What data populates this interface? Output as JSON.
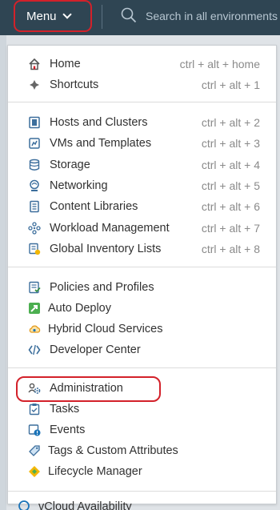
{
  "topbar": {
    "menu_label": "Menu",
    "search_placeholder": "Search in all environments"
  },
  "menu": {
    "group1": [
      {
        "label": "Home",
        "shortcut": "ctrl + alt + home",
        "icon": "home-icon"
      },
      {
        "label": "Shortcuts",
        "shortcut": "ctrl + alt + 1",
        "icon": "shortcuts-icon"
      }
    ],
    "group2": [
      {
        "label": "Hosts and Clusters",
        "shortcut": "ctrl + alt + 2",
        "icon": "hosts-clusters-icon"
      },
      {
        "label": "VMs and Templates",
        "shortcut": "ctrl + alt + 3",
        "icon": "vms-templates-icon"
      },
      {
        "label": "Storage",
        "shortcut": "ctrl + alt + 4",
        "icon": "storage-icon"
      },
      {
        "label": "Networking",
        "shortcut": "ctrl + alt + 5",
        "icon": "networking-icon"
      },
      {
        "label": "Content Libraries",
        "shortcut": "ctrl + alt + 6",
        "icon": "content-libraries-icon"
      },
      {
        "label": "Workload Management",
        "shortcut": "ctrl + alt + 7",
        "icon": "workload-management-icon"
      },
      {
        "label": "Global Inventory Lists",
        "shortcut": "ctrl + alt + 8",
        "icon": "global-inventory-icon"
      }
    ],
    "group3": [
      {
        "label": "Policies and Profiles",
        "icon": "policies-profiles-icon"
      },
      {
        "label": "Auto Deploy",
        "icon": "auto-deploy-icon"
      },
      {
        "label": "Hybrid Cloud Services",
        "icon": "hybrid-cloud-icon"
      },
      {
        "label": "Developer Center",
        "icon": "developer-center-icon"
      }
    ],
    "group4": [
      {
        "label": "Administration",
        "icon": "administration-icon"
      },
      {
        "label": "Tasks",
        "icon": "tasks-icon"
      },
      {
        "label": "Events",
        "icon": "events-icon"
      },
      {
        "label": "Tags & Custom Attributes",
        "icon": "tags-icon"
      },
      {
        "label": "Lifecycle Manager",
        "icon": "lifecycle-manager-icon"
      }
    ],
    "partial_item": "vCloud Availability"
  },
  "colors": {
    "topbar": "#2f4553",
    "highlight": "#d3212a",
    "accent_blue": "#1a73b8"
  }
}
